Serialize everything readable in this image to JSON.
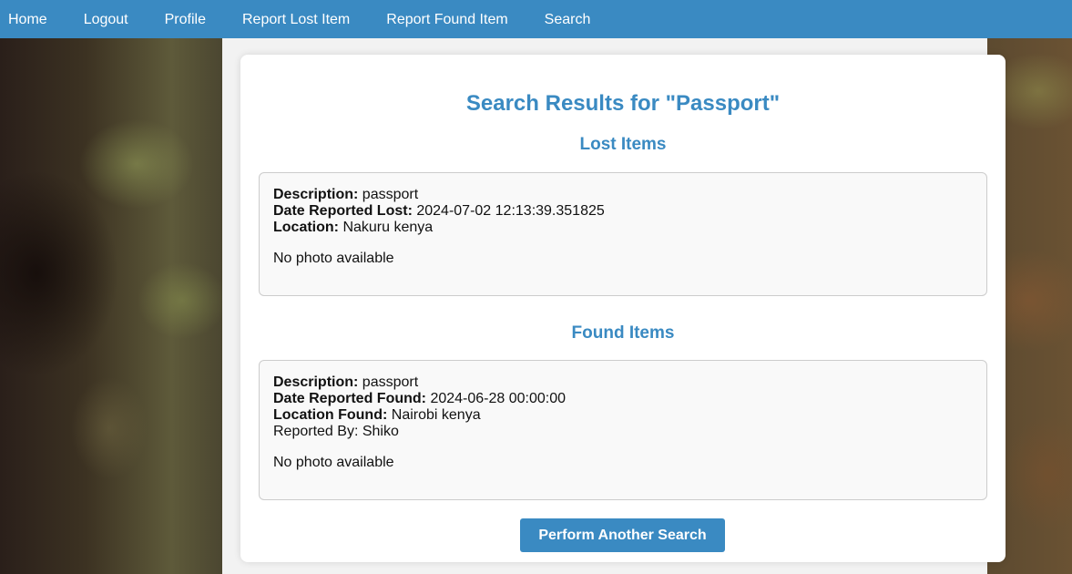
{
  "nav": {
    "items": [
      {
        "label": "Home"
      },
      {
        "label": "Logout"
      },
      {
        "label": "Profile"
      },
      {
        "label": "Report Lost Item"
      },
      {
        "label": "Report Found Item"
      },
      {
        "label": "Search"
      }
    ]
  },
  "page": {
    "title": "Search Results for \"Passport\""
  },
  "lost": {
    "section_title": "Lost Items",
    "items": [
      {
        "description_label": "Description:",
        "description": "passport",
        "date_label": "Date Reported Lost:",
        "date": "2024-07-02 12:13:39.351825",
        "location_label": "Location:",
        "location": "Nakuru kenya",
        "photo_note": "No photo available"
      }
    ]
  },
  "found": {
    "section_title": "Found Items",
    "items": [
      {
        "description_label": "Description:",
        "description": "passport",
        "date_label": "Date Reported Found:",
        "date": "2024-06-28 00:00:00",
        "location_label": "Location Found:",
        "location": "Nairobi kenya",
        "reported_by": "Reported By: Shiko",
        "photo_note": "No photo available"
      }
    ]
  },
  "actions": {
    "search_again_label": "Perform Another Search"
  },
  "colors": {
    "accent": "#3a8ac2",
    "card_bg": "#ffffff",
    "item_bg": "#f9f9f9"
  }
}
